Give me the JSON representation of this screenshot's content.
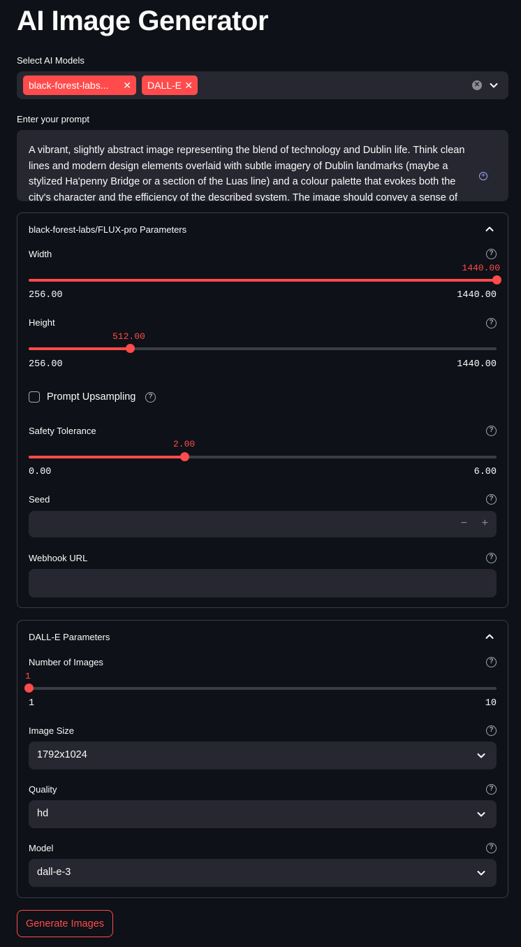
{
  "app": {
    "title": "AI Image Generator"
  },
  "models": {
    "label": "Select AI Models",
    "selected": [
      {
        "label": "black-forest-labs..."
      },
      {
        "label": "DALL-E"
      }
    ]
  },
  "prompt": {
    "label": "Enter your prompt",
    "value": "A vibrant, slightly abstract image representing the blend of technology and Dublin life. Think clean lines and modern design elements overlaid with subtle imagery of Dublin landmarks (maybe a stylized Ha'penny Bridge or a section of the Luas line) and a colour palette that evokes both the city's character and the efficiency of the described system. The image should convey a sense of ease"
  },
  "flux": {
    "title": "black-forest-labs/FLUX-pro Parameters",
    "width": {
      "label": "Width",
      "value": "1440.00",
      "min": "256.00",
      "max": "1440.00",
      "fraction": 1.0
    },
    "height": {
      "label": "Height",
      "value": "512.00",
      "min": "256.00",
      "max": "1440.00",
      "fraction": 0.2162
    },
    "upsampling": {
      "label": "Prompt Upsampling",
      "checked": false
    },
    "safety": {
      "label": "Safety Tolerance",
      "value": "2.00",
      "min": "0.00",
      "max": "6.00",
      "fraction": 0.3333
    },
    "seed": {
      "label": "Seed",
      "value": "",
      "minus": "−",
      "plus": "+"
    },
    "webhook": {
      "label": "Webhook URL",
      "value": ""
    }
  },
  "dalle": {
    "title": "DALL-E Parameters",
    "num_images": {
      "label": "Number of Images",
      "value": "1",
      "min": "1",
      "max": "10",
      "fraction": 0.0
    },
    "size": {
      "label": "Image Size",
      "value": "1792x1024"
    },
    "quality": {
      "label": "Quality",
      "value": "hd"
    },
    "model": {
      "label": "Model",
      "value": "dall-e-3"
    }
  },
  "actions": {
    "generate_label": "Generate Images"
  },
  "colors": {
    "accent": "#ff4b4b",
    "background": "#0e1117",
    "input_bg": "#262730",
    "border": "#3a3d46"
  },
  "icons": {
    "help": "question-circle-icon",
    "chevron": "chevron-icon",
    "clear": "clear-circle-icon"
  }
}
